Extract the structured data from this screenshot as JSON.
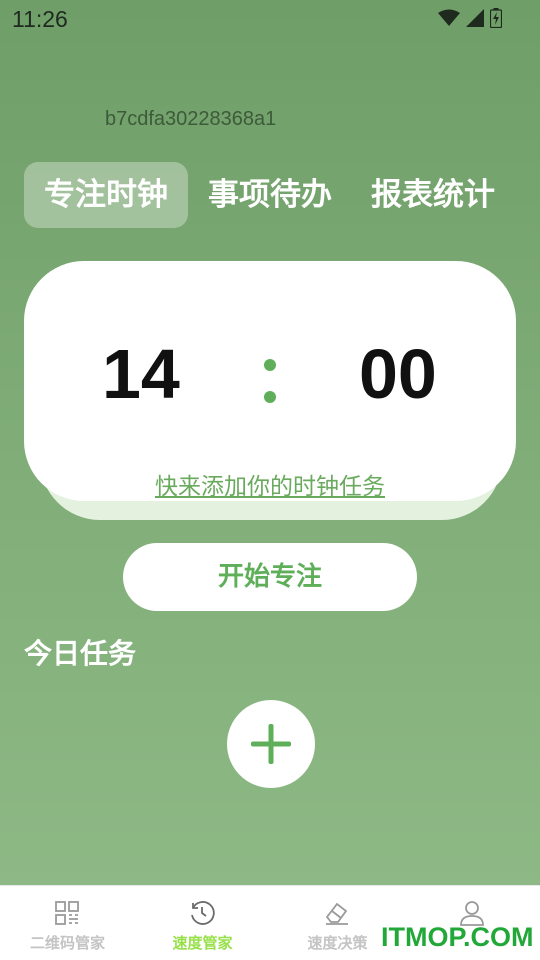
{
  "status_bar": {
    "time": "11:26",
    "icons": [
      "wifi-icon",
      "cellular-signal-icon",
      "battery-charging-icon"
    ]
  },
  "header": {
    "id_text": "b7cdfa30228368a1"
  },
  "tabs": [
    {
      "label": "专注时钟",
      "active": true
    },
    {
      "label": "事项待办",
      "active": false
    },
    {
      "label": "报表统计",
      "active": false
    }
  ],
  "clock": {
    "minutes": "14",
    "seconds": "00",
    "add_task_link": "快来添加你的时钟任务"
  },
  "start_button_label": "开始专注",
  "today": {
    "title": "今日任务",
    "add_icon": "plus-icon"
  },
  "bottom_nav": [
    {
      "label": "二维码管家",
      "icon": "qr-grid-icon",
      "active": false
    },
    {
      "label": "速度管家",
      "icon": "history-clock-icon",
      "active": true
    },
    {
      "label": "速度决策",
      "icon": "eraser-icon",
      "active": false
    },
    {
      "label": "",
      "icon": "user-icon",
      "active": false
    }
  ],
  "watermark": "ITMOP.COM",
  "colors": {
    "accent_green": "#5faf5a",
    "nav_active": "#98e04a",
    "nav_inactive": "#c4c4c4",
    "background_top": "#6f9e68",
    "background_bottom": "#90bb88"
  }
}
